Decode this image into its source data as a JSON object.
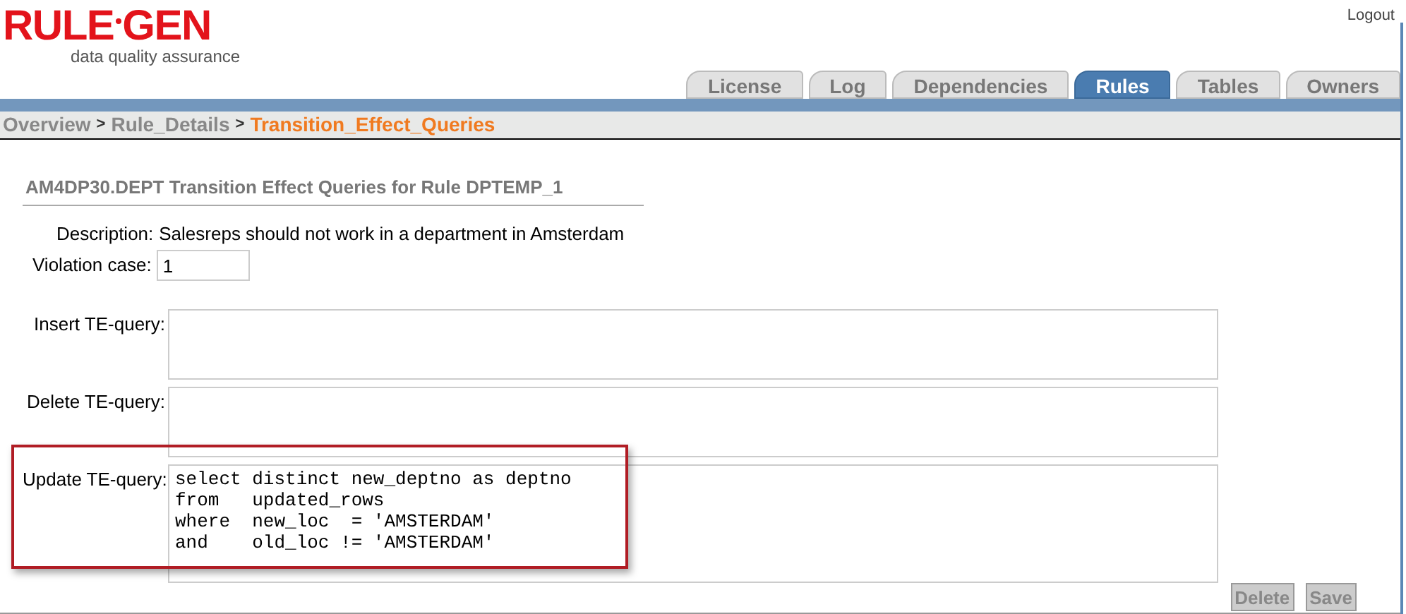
{
  "logo": {
    "left": "RULE",
    "right": "GEN",
    "tagline": "data quality assurance"
  },
  "logout": "Logout",
  "tabs": [
    {
      "label": "License",
      "selected": false
    },
    {
      "label": "Log",
      "selected": false
    },
    {
      "label": "Dependencies",
      "selected": false
    },
    {
      "label": "Rules",
      "selected": true
    },
    {
      "label": "Tables",
      "selected": false
    },
    {
      "label": "Owners",
      "selected": false
    }
  ],
  "breadcrumb": [
    {
      "label": "Overview",
      "selected": false
    },
    {
      "separator": ">",
      "label": "Rule_Details",
      "selected": false
    },
    {
      "separator": ">",
      "label": "Transition_Effect_Queries",
      "selected": true
    }
  ],
  "heading": "AM4DP30.DEPT Transition Effect Queries for Rule DPTEMP_1",
  "description": {
    "label": "Description:",
    "value": "Salesreps should not work in a department in Amsterdam"
  },
  "violation_case": {
    "label": "Violation case:",
    "value": "1"
  },
  "queries": [
    {
      "label": "Insert TE-query:",
      "highlighted": false
    },
    {
      "label": "Delete TE-query:",
      "highlighted": false
    },
    {
      "label": "Update TE-query:",
      "value": "select distinct new_deptno as deptno\nfrom   updated_rows\nwhere  new_loc  = 'AMSTERDAM'\nand    old_loc != 'AMSTERDAM'",
      "highlighted": true
    }
  ],
  "buttons": [
    {
      "label": "Delete",
      "disabled": true
    },
    {
      "label": "Save",
      "disabled": true
    }
  ]
}
